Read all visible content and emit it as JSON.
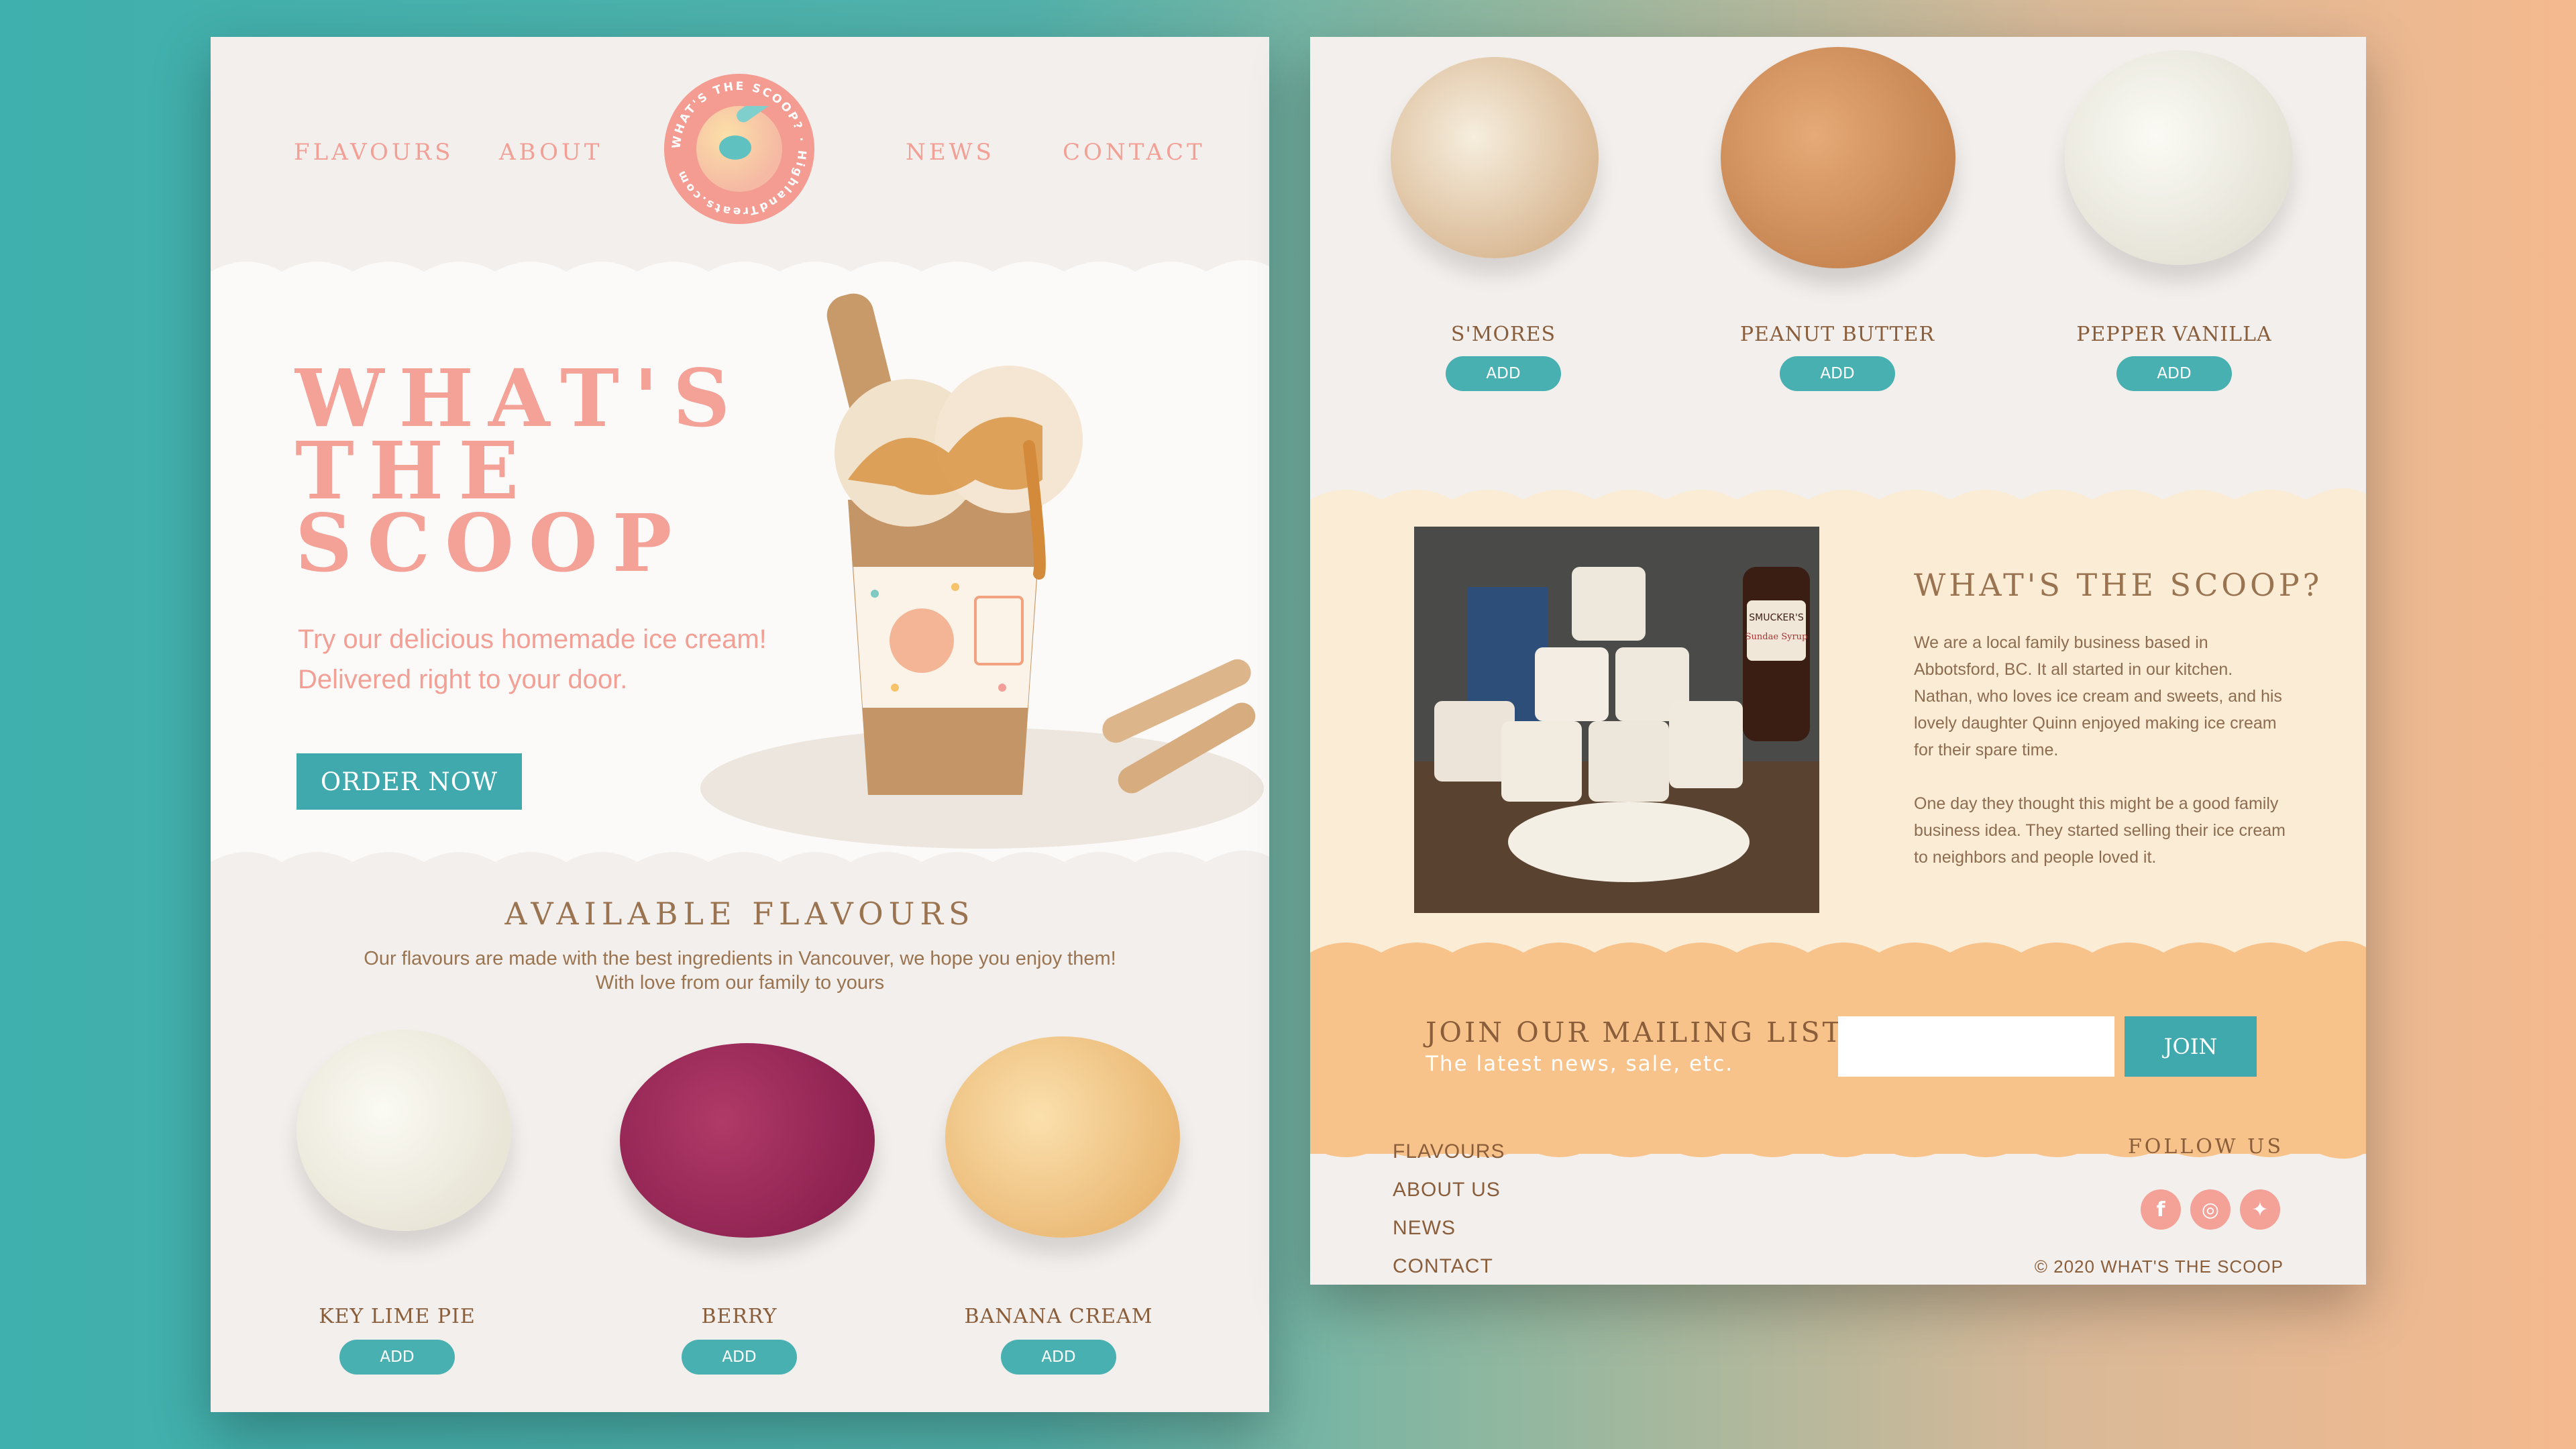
{
  "nav": {
    "flavours": "FLAVOURS",
    "about": "ABOUT",
    "news": "NEWS",
    "contact": "CONTACT",
    "logo_ring_text": "WHAT'S THE SCOOP? · HighlandTreats.com"
  },
  "hero": {
    "title_line1": "WHAT'S",
    "title_line2": "THE",
    "title_line3": "SCOOP",
    "subtitle_line1": "Try our delicious homemade ice cream!",
    "subtitle_line2": "Delivered right to your door.",
    "order_button": "ORDER NOW"
  },
  "available": {
    "heading": "AVAILABLE  FLAVOURS",
    "text_line1": "Our flavours are made with the best ingredients in Vancouver,  we hope you enjoy them!",
    "text_line2": "With love from our family to yours"
  },
  "flavours_left": [
    {
      "name": "KEY LIME PIE",
      "add": "ADD"
    },
    {
      "name": "BERRY",
      "add": "ADD"
    },
    {
      "name": "BANANA CREAM",
      "add": "ADD"
    }
  ],
  "flavours_right": [
    {
      "name": "S'MORES",
      "add": "ADD"
    },
    {
      "name": "PEANUT BUTTER",
      "add": "ADD"
    },
    {
      "name": "PEPPER VANILLA",
      "add": "ADD"
    }
  ],
  "about": {
    "heading": "WHAT'S THE SCOOP?",
    "para1": "We are a local family business based in Abbotsford, BC. It all started in our kitchen. Nathan, who loves ice cream and sweets, and his lovely daughter Quinn enjoyed making ice cream for their spare time.",
    "para2": "One day they thought this might be a good family business idea. They started selling their ice cream to neighbors and people loved it.",
    "photo_label1": "SMUCKER'S",
    "photo_label2": "Sundae Syrup"
  },
  "mailing": {
    "heading": "JOIN OUR MAILING LIST",
    "sub": "The latest news, sale, etc.",
    "email_placeholder": "",
    "join": "JOIN"
  },
  "footer": {
    "links": [
      "FLAVOURS",
      "ABOUT US",
      "NEWS",
      "CONTACT"
    ],
    "follow": "FOLLOW US",
    "copyright": "© 2020 WHAT'S THE SCOOP"
  },
  "colors": {
    "accent_teal": "#3fa9ad",
    "pink": "#f4a197",
    "brown": "#8a5e3b",
    "peach": "#f8c38b",
    "cream": "#fbecd6"
  }
}
